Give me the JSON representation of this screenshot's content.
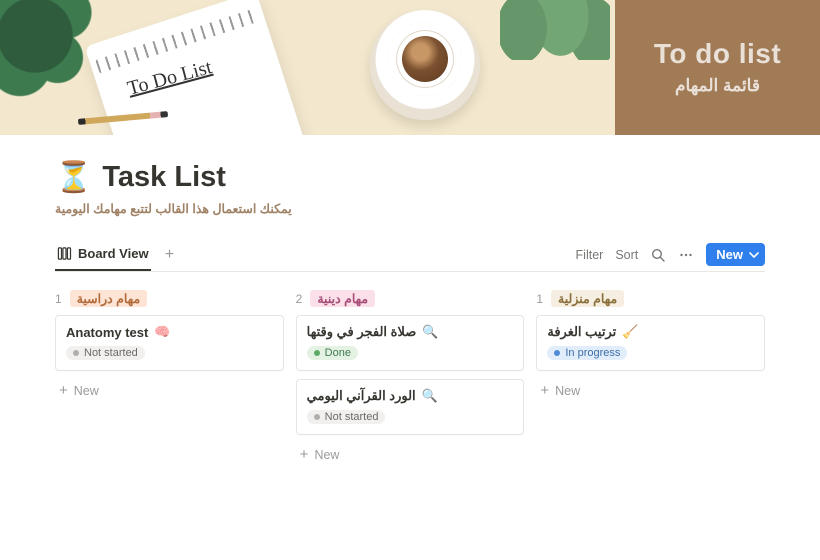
{
  "cover": {
    "title_en": "To do list",
    "title_ar": "قائمة المهام",
    "notepad_text": "To Do List"
  },
  "page": {
    "emoji": "⏳",
    "title": "Task List",
    "subtitle": "يمكنك استعمال هذا القالب لتتبع مهامك اليومية"
  },
  "viewbar": {
    "current": "Board View",
    "filter": "Filter",
    "sort": "Sort",
    "new": "New"
  },
  "board": {
    "columns": [
      {
        "tag": "مهام دراسية",
        "tag_style": "peach",
        "count": "1",
        "cards": [
          {
            "icon": "🧠",
            "title": "Anatomy test",
            "status": "Not started",
            "status_style": "default"
          }
        ]
      },
      {
        "tag": "مهام دينية",
        "tag_style": "pink",
        "count": "2",
        "cards": [
          {
            "icon": "🔍",
            "title": "صلاة الفجر في وقتها",
            "status": "Done",
            "status_style": "done"
          },
          {
            "icon": "🔍",
            "title": "الورد القرآني اليومي",
            "status": "Not started",
            "status_style": "default"
          }
        ]
      },
      {
        "tag": "مهام منزلية",
        "tag_style": "sand",
        "count": "1",
        "cards": [
          {
            "icon": "🧹",
            "title": "ترتيب الغرفة",
            "status": "In progress",
            "status_style": "prog"
          }
        ]
      }
    ],
    "add_label": "New"
  }
}
